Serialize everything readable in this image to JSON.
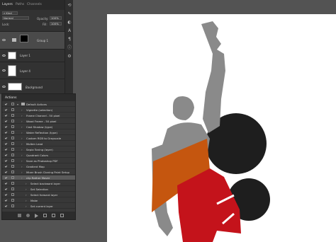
{
  "layers_panel": {
    "tabs": [
      "Layers",
      "Paths",
      "Channels"
    ],
    "kind_filter": "Kind",
    "blend_mode": "Normal",
    "opacity_label": "Opacity:",
    "opacity_value": "100%",
    "lock_label": "Lock:",
    "fill_label": "Fill:",
    "fill_value": "100%",
    "layers": [
      {
        "name": "Group 1"
      },
      {
        "name": "Layer 1"
      },
      {
        "name": "Layer 4"
      },
      {
        "name": "Background"
      }
    ]
  },
  "actions_panel": {
    "title": "Actions",
    "items": [
      {
        "label": "Default Actions",
        "level": 0
      },
      {
        "label": "Vignette (selection)",
        "level": 1
      },
      {
        "label": "Frame Channel - 50 pixel",
        "level": 1
      },
      {
        "label": "Wood Frame - 50 pixel",
        "level": 1
      },
      {
        "label": "Cast Shadow (type)",
        "level": 1
      },
      {
        "label": "Water Reflection (type)",
        "level": 1
      },
      {
        "label": "Custom RGB to Grayscale",
        "level": 1
      },
      {
        "label": "Molten Lead",
        "level": 1
      },
      {
        "label": "Sepia Toning (layer)",
        "level": 1
      },
      {
        "label": "Quadrant Colors",
        "level": 1
      },
      {
        "label": "Save as Photoshop PDF",
        "level": 1
      },
      {
        "label": "Gradient Map",
        "level": 1
      },
      {
        "label": "Mixer Brush Cloning Paint Setup",
        "level": 1
      },
      {
        "label": "clip Rather Mover",
        "level": 1
      },
      {
        "label": "Select backward layer",
        "level": 2
      },
      {
        "label": "Set Selection",
        "level": 2
      },
      {
        "label": "Select forward layer",
        "level": 2
      },
      {
        "label": "Make",
        "level": 2
      },
      {
        "label": "Set current layer",
        "level": 2
      }
    ],
    "selected_index": 13
  },
  "colors": {
    "panel_bg": "#323232",
    "canvas": "#ffffff",
    "figure_gray": "#8a8a8a",
    "sash_orange": "#c5560f",
    "shorts_red": "#c4131b",
    "ball_black": "#1e1e1e"
  }
}
